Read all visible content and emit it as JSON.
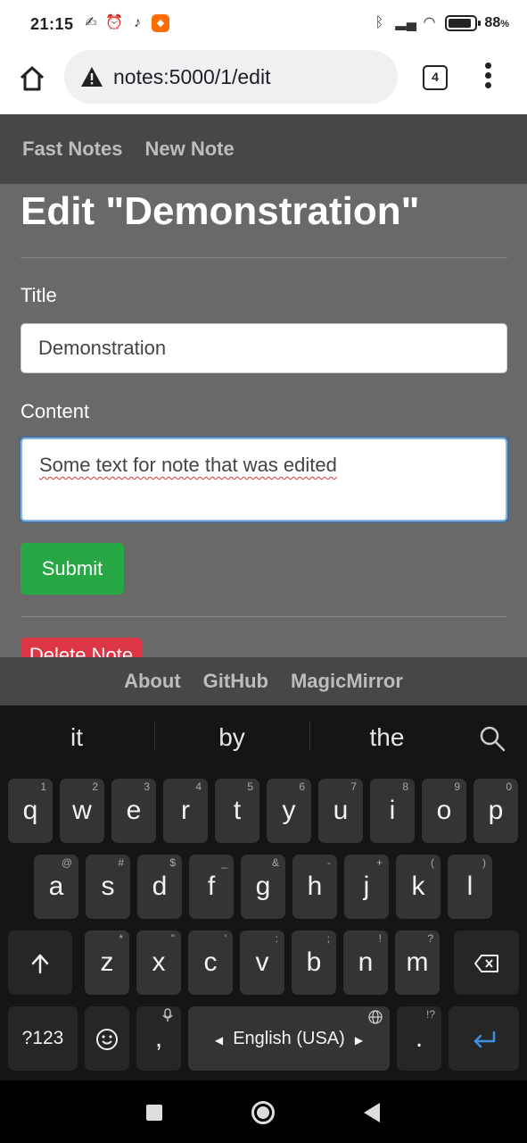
{
  "status_bar": {
    "time": "21:15",
    "battery_percent": "88",
    "battery_suffix": "%",
    "battery_level": 0.88,
    "left_icons": [
      "alarm-off-icon",
      "alarm-clock-icon",
      "music-note-icon",
      "app-notification-icon"
    ],
    "right_icons": [
      "bluetooth-icon",
      "signal-icon",
      "wifi-icon",
      "battery-icon"
    ]
  },
  "browser": {
    "url": "notes:5000/1/edit",
    "tab_count": "4",
    "security_icon": "warning-icon"
  },
  "navbar": {
    "brand": "Fast Notes",
    "new_note": "New Note"
  },
  "page": {
    "title": "Edit \"Demonstration\"",
    "title_label": "Title",
    "title_value": "Demonstration",
    "content_label": "Content",
    "content_value": "Some text for note that was edited",
    "submit_label": "Submit",
    "delete_label": "Delete Note"
  },
  "footer": {
    "links": [
      "About",
      "GitHub",
      "MagicMirror"
    ]
  },
  "keyboard": {
    "suggestions": [
      "it",
      "by",
      "the"
    ],
    "row1": [
      {
        "k": "q",
        "h": "1"
      },
      {
        "k": "w",
        "h": "2"
      },
      {
        "k": "e",
        "h": "3"
      },
      {
        "k": "r",
        "h": "4"
      },
      {
        "k": "t",
        "h": "5"
      },
      {
        "k": "y",
        "h": "6"
      },
      {
        "k": "u",
        "h": "7"
      },
      {
        "k": "i",
        "h": "8"
      },
      {
        "k": "o",
        "h": "9"
      },
      {
        "k": "p",
        "h": "0"
      }
    ],
    "row2": [
      {
        "k": "a",
        "h": "@"
      },
      {
        "k": "s",
        "h": "#"
      },
      {
        "k": "d",
        "h": "$"
      },
      {
        "k": "f",
        "h": "_"
      },
      {
        "k": "g",
        "h": "&"
      },
      {
        "k": "h",
        "h": "-"
      },
      {
        "k": "j",
        "h": "+"
      },
      {
        "k": "k",
        "h": "("
      },
      {
        "k": "l",
        "h": ")"
      }
    ],
    "row3": [
      {
        "k": "z",
        "h": "*"
      },
      {
        "k": "x",
        "h": "\""
      },
      {
        "k": "c",
        "h": "'"
      },
      {
        "k": "v",
        "h": ":"
      },
      {
        "k": "b",
        "h": ";"
      },
      {
        "k": "n",
        "h": "!"
      },
      {
        "k": "m",
        "h": "?"
      }
    ],
    "symbols_label": "?123",
    "comma": ",",
    "space_label": "English (USA)",
    "period": ".",
    "period_hint": "!?",
    "shift_icon": "shift-arrow-icon",
    "backspace_icon": "backspace-icon",
    "enter_icon": "enter-icon",
    "emoji_icon": "emoji-icon",
    "mic_icon": "microphone-icon",
    "globe_icon": "globe-icon",
    "accent_color": "#3d8fe0"
  }
}
